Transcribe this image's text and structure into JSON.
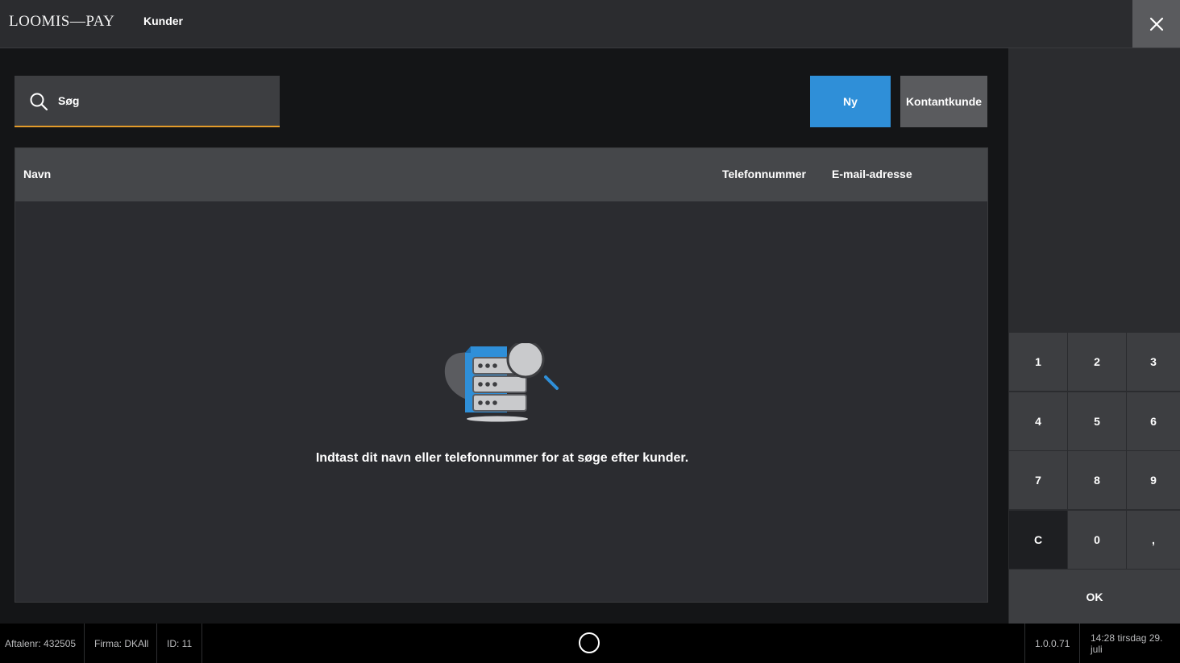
{
  "header": {
    "logo": "LOOMIS—PAY",
    "title": "Kunder",
    "close_icon": "close-icon"
  },
  "search": {
    "placeholder": "Søg",
    "value": "",
    "icon": "search-icon",
    "accent_color": "#e39b2a"
  },
  "actions": {
    "new_label": "Ny",
    "cash_customer_label": "Kontantkunde",
    "new_color": "#2f8fd8"
  },
  "table": {
    "columns": [
      "Navn",
      "Telefonnummer",
      "E-mail-adresse"
    ],
    "rows": [],
    "empty_icon": "database-search-icon",
    "empty_message": "Indtast dit navn eller telefonnummer for at søge efter kunder."
  },
  "keypad": {
    "keys": [
      "1",
      "2",
      "3",
      "4",
      "5",
      "6",
      "7",
      "8",
      "9",
      "C",
      "0",
      ","
    ],
    "ok_label": "OK"
  },
  "status": {
    "agreement": "Aftalenr: 432505",
    "company": "Firma: DKAll",
    "id": "ID: 11",
    "version": "1.0.0.71",
    "datetime": "14:28 tirsdag 29. juli"
  }
}
